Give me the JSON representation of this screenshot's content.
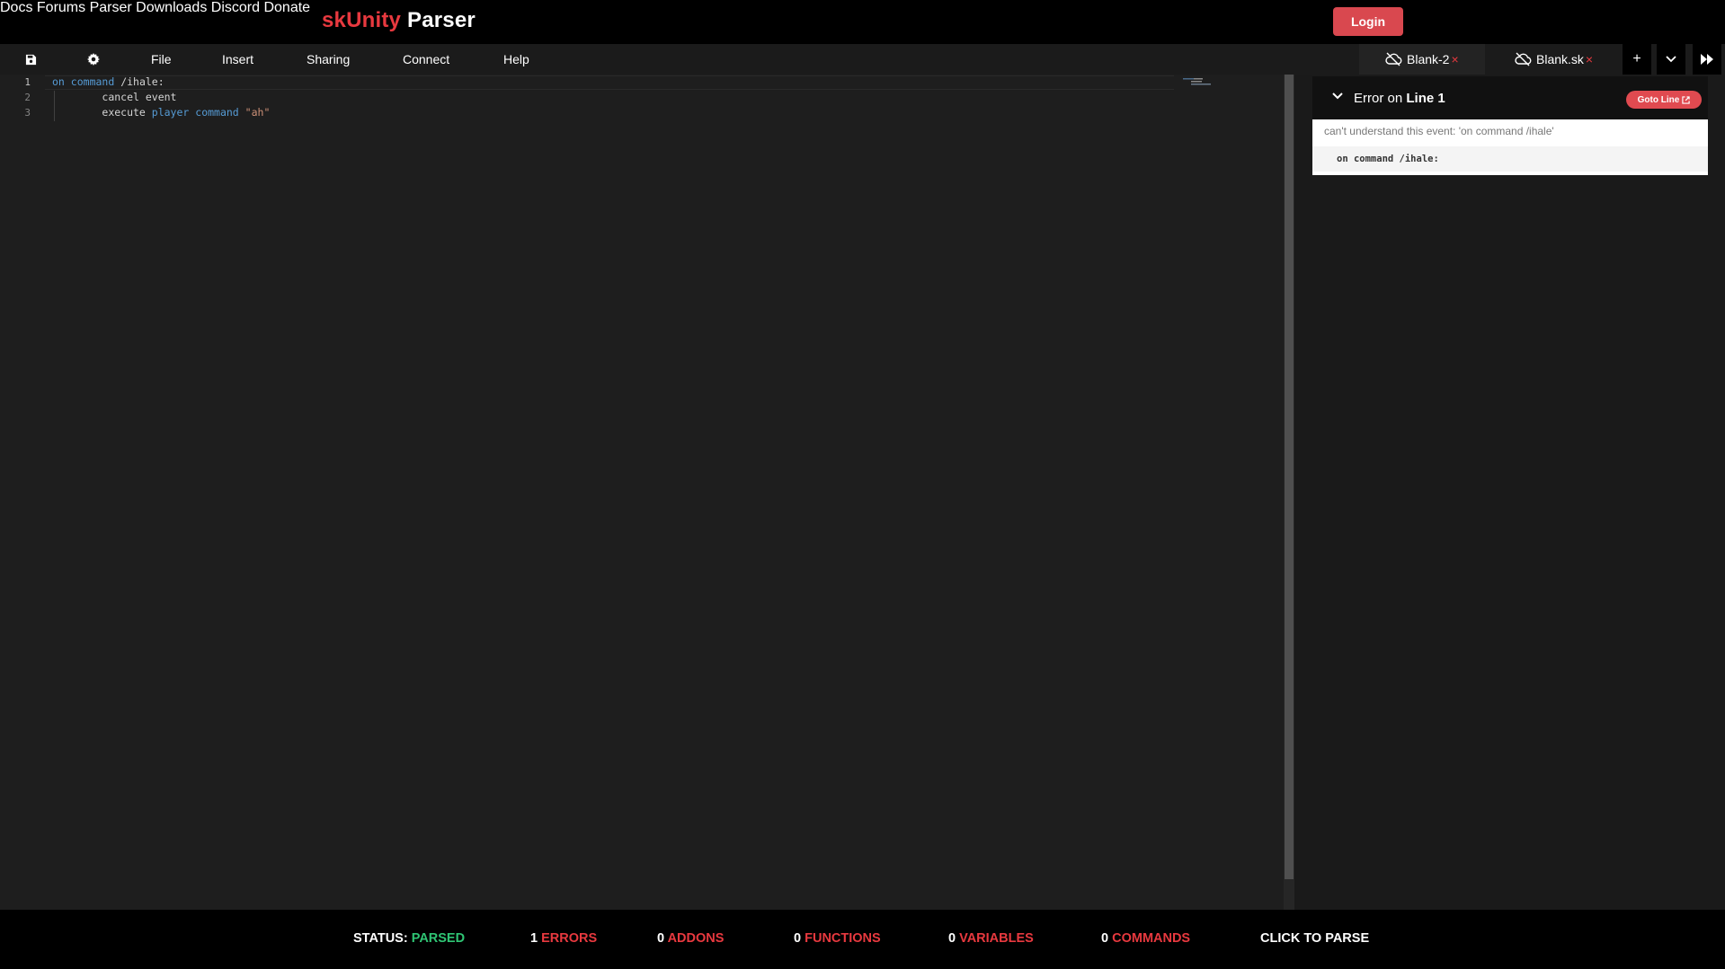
{
  "brand": {
    "part1": "skUnity",
    "part2": "Parser"
  },
  "nav": {
    "items": [
      "Docs",
      "Forums",
      "Parser",
      "Downloads",
      "Discord",
      "Donate"
    ],
    "login_label": "Login"
  },
  "menubar": {
    "items": [
      "File",
      "Insert",
      "Sharing",
      "Connect",
      "Help"
    ],
    "save_icon": "save-icon",
    "settings_icon": "gear-icon"
  },
  "tabs": [
    {
      "label": "Blank-2",
      "close": "×"
    },
    {
      "label": "Blank.sk",
      "close": "×"
    }
  ],
  "tab_controls": {
    "add": "+",
    "dropdown": "chevron-down-icon",
    "collapse": "fast-forward-icon"
  },
  "editor": {
    "line_numbers": [
      "1",
      "2",
      "3"
    ],
    "lines": [
      {
        "indent": "",
        "tokens": [
          {
            "t": "on",
            "c": "kw"
          },
          {
            "t": " ",
            "c": ""
          },
          {
            "t": "command",
            "c": "kw"
          },
          {
            "t": " /ihale:",
            "c": ""
          }
        ]
      },
      {
        "indent": "        ",
        "tokens": [
          {
            "t": "cancel event",
            "c": ""
          }
        ]
      },
      {
        "indent": "        ",
        "tokens": [
          {
            "t": "execute ",
            "c": ""
          },
          {
            "t": "player",
            "c": "kw"
          },
          {
            "t": " ",
            "c": ""
          },
          {
            "t": "command",
            "c": "kw"
          },
          {
            "t": " ",
            "c": ""
          },
          {
            "t": "\"ah\"",
            "c": "str"
          }
        ]
      }
    ]
  },
  "error_panel": {
    "title_prefix": "Error on ",
    "title_line": "Line 1",
    "goto_label": "Goto Line",
    "message": "can't understand this event: 'on command /ihale'",
    "code": "on command /ihale:"
  },
  "status": {
    "status_label": "STATUS:",
    "status_value": "PARSED",
    "errors_count": "1",
    "errors_label": "ERRORS",
    "addons_count": "0",
    "addons_label": "ADDONS",
    "functions_count": "0",
    "functions_label": "FUNCTIONS",
    "variables_count": "0",
    "variables_label": "VARIABLES",
    "commands_count": "0",
    "commands_label": "COMMANDS",
    "parse_label": "CLICK TO PARSE"
  },
  "colors": {
    "accent_red": "#e8393f",
    "status_green": "#2fc574",
    "keyword_blue": "#569cd6",
    "string_orange": "#ce9178"
  }
}
